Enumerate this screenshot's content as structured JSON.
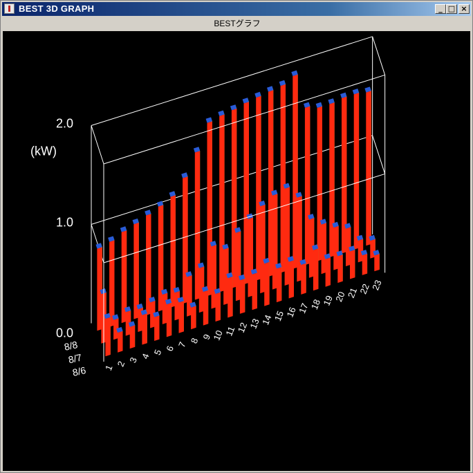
{
  "window": {
    "title": "BEST 3D GRAPH",
    "minimize_label": "_",
    "maximize_label": "□",
    "close_label": "×"
  },
  "graph_label": "BESTグラフ",
  "colors": {
    "background": "#000000",
    "frame": "#ffffff",
    "bar_front": "#ff2a10",
    "bar_side": "#6fbf3a",
    "bar_top": "#2a5bd8"
  },
  "chart_data": {
    "type": "bar",
    "style": "3d",
    "unit_label": "(kW)",
    "z_ticks": [
      "0.0",
      "1.0",
      "2.0"
    ],
    "zlim": [
      0,
      2
    ],
    "categories": [
      "1",
      "2",
      "3",
      "4",
      "5",
      "6",
      "7",
      "8",
      "9",
      "10",
      "11",
      "12",
      "13",
      "14",
      "15",
      "16",
      "17",
      "18",
      "19",
      "20",
      "21",
      "22",
      "23"
    ],
    "series": [
      {
        "name": "8/6",
        "values": [
          0.38,
          0.2,
          0.22,
          0.3,
          0.24,
          0.33,
          0.31,
          0.22,
          0.34,
          0.28,
          0.4,
          0.34,
          0.36,
          0.43,
          0.34,
          0.37,
          0.3,
          0.41,
          0.28,
          0.27,
          0.28,
          0.2,
          0.16
        ]
      },
      {
        "name": "8/7",
        "values": [
          0.5,
          0.2,
          0.24,
          0.23,
          0.26,
          0.3,
          0.28,
          0.4,
          0.45,
          0.63,
          0.56,
          0.69,
          0.79,
          0.88,
          0.95,
          0.98,
          0.85,
          0.59,
          0.5,
          0.43,
          0.38,
          0.22,
          0.18
        ]
      },
      {
        "name": "8/8",
        "values": [
          0.83,
          0.86,
          0.92,
          0.96,
          1.01,
          1.06,
          1.12,
          1.27,
          1.49,
          1.75,
          1.78,
          1.8,
          1.83,
          1.85,
          1.87,
          1.89,
          1.95,
          1.59,
          1.55,
          1.55,
          1.57,
          1.57,
          1.55
        ]
      }
    ]
  }
}
